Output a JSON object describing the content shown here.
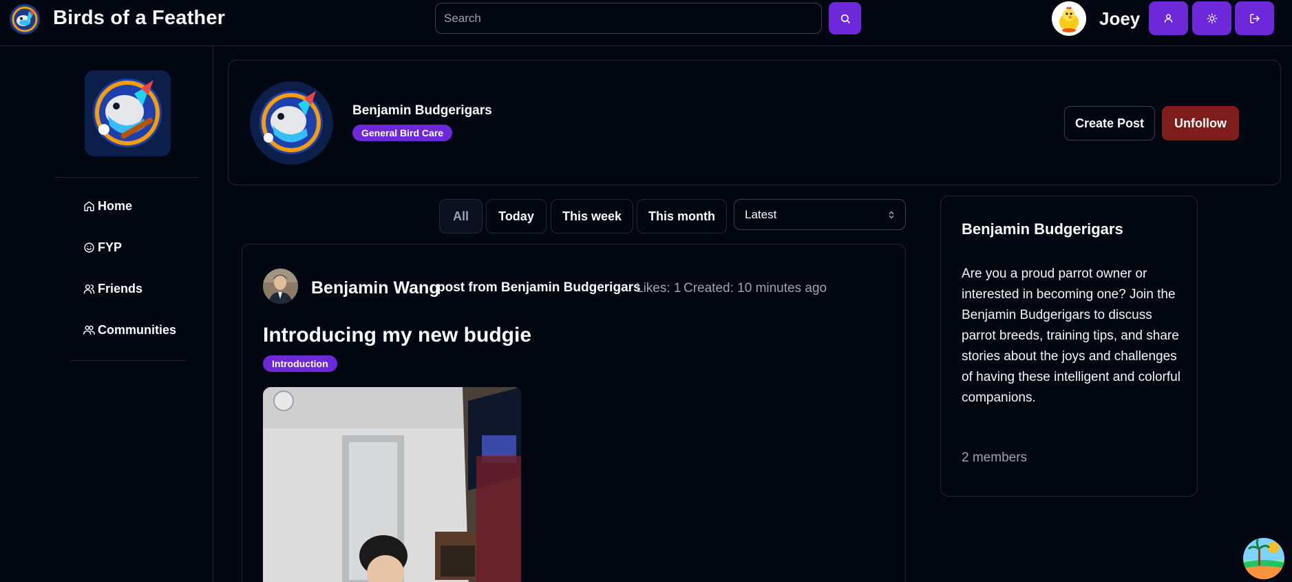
{
  "header": {
    "app_title": "Birds of a Feather",
    "logo_icon": "parrot-logo-icon",
    "search": {
      "placeholder": "Search",
      "value": ""
    },
    "user": {
      "name": "Joey",
      "avatar_icon": "chicken-avatar-icon"
    },
    "buttons": [
      "profile-icon",
      "theme-sun-icon",
      "logout-icon"
    ],
    "accent_color": "#6d28d9"
  },
  "sidebar": {
    "logo_icon": "budgie-logo-icon",
    "items": [
      {
        "label": "Home",
        "icon": "home-icon"
      },
      {
        "label": "FYP",
        "icon": "smile-icon"
      },
      {
        "label": "Friends",
        "icon": "user-icon"
      },
      {
        "label": "Communities",
        "icon": "users-icon"
      }
    ]
  },
  "community": {
    "name": "Benjamin Budgerigars",
    "category": "General Bird Care",
    "create_post_label": "Create Post",
    "unfollow_label": "Unfollow",
    "unfollow_color": "#7f1d1d"
  },
  "filters": {
    "options": [
      "All",
      "Today",
      "This week",
      "This month"
    ],
    "active": "All",
    "sort": {
      "selected": "Latest"
    }
  },
  "post": {
    "author": "Benjamin Wang",
    "from": "post from Benjamin Budgerigars",
    "likes": "Likes: 1",
    "created": "Created: 10 minutes ago",
    "title": "Introducing my new budgie",
    "tag": "Introduction"
  },
  "about": {
    "title": "Benjamin Budgerigars",
    "description": "Are you a proud parrot owner or interested in becoming one? Join the Benjamin Budgerigars to discuss parrot breeds, training tips, and share stories about the joys and challenges of having these intelligent and colorful companions.",
    "members": "2 members"
  }
}
